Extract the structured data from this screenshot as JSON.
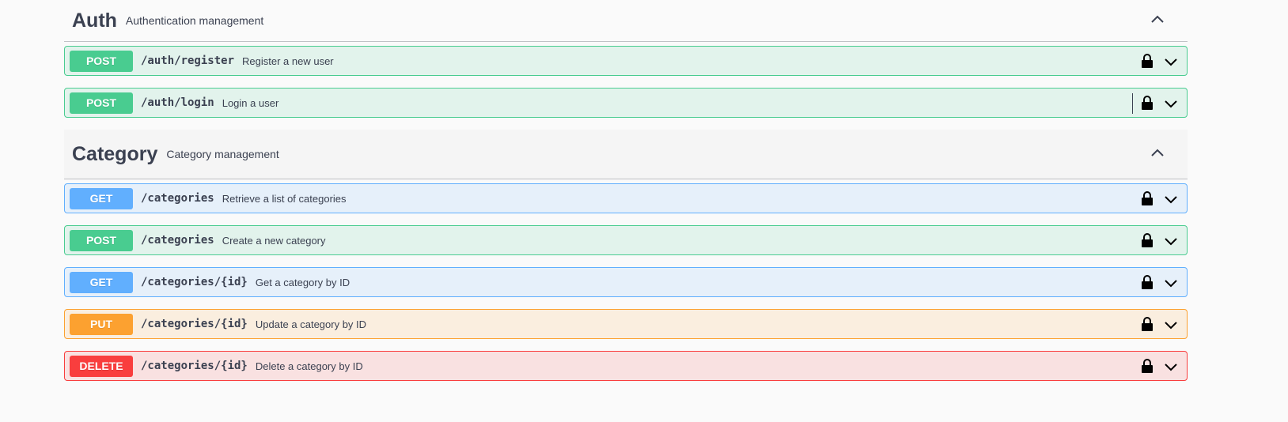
{
  "sections": [
    {
      "name": "Auth",
      "description": "Authentication management",
      "operations": [
        {
          "method": "POST",
          "path": "/auth/register",
          "summary": "Register a new user"
        },
        {
          "method": "POST",
          "path": "/auth/login",
          "summary": "Login a user"
        }
      ]
    },
    {
      "name": "Category",
      "description": "Category management",
      "operations": [
        {
          "method": "GET",
          "path": "/categories",
          "summary": "Retrieve a list of categories"
        },
        {
          "method": "POST",
          "path": "/categories",
          "summary": "Create a new category"
        },
        {
          "method": "GET",
          "path": "/categories/{id}",
          "summary": "Get a category by ID"
        },
        {
          "method": "PUT",
          "path": "/categories/{id}",
          "summary": "Update a category by ID"
        },
        {
          "method": "DELETE",
          "path": "/categories/{id}",
          "summary": "Delete a category by ID"
        }
      ]
    }
  ],
  "icons": {
    "lock": "lock-icon",
    "chevron": "chevron-down-icon",
    "collapse": "chevron-up-icon"
  },
  "colors": {
    "post": "#49cc90",
    "get": "#61affe",
    "put": "#fca130",
    "delete": "#f93e3e",
    "text": "#3b4151"
  }
}
